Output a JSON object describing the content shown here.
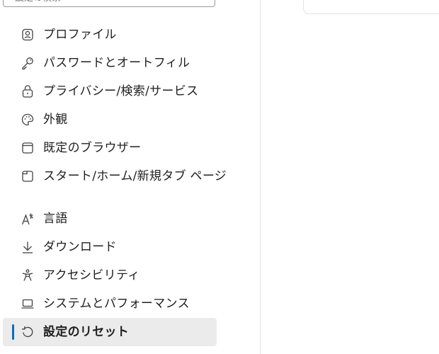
{
  "search": {
    "placeholder": "設定の検索"
  },
  "sidebar": {
    "items": [
      {
        "label": "プロファイル",
        "icon": "profile-icon",
        "selected": false
      },
      {
        "label": "パスワードとオートフィル",
        "icon": "key-icon",
        "selected": false
      },
      {
        "label": "プライバシー/検索/サービス",
        "icon": "lock-icon",
        "selected": false
      },
      {
        "label": "外観",
        "icon": "palette-icon",
        "selected": false
      },
      {
        "label": "既定のブラウザー",
        "icon": "browser-window-icon",
        "selected": false
      },
      {
        "label": "スタート/ホーム/新規タブ ページ",
        "icon": "home-page-icon",
        "selected": false
      },
      {
        "label": "言語",
        "icon": "language-icon",
        "selected": false
      },
      {
        "label": "ダウンロード",
        "icon": "download-icon",
        "selected": false
      },
      {
        "label": "アクセシビリティ",
        "icon": "accessibility-icon",
        "selected": false
      },
      {
        "label": "システムとパフォーマンス",
        "icon": "laptop-icon",
        "selected": false
      },
      {
        "label": "設定のリセット",
        "icon": "reset-icon",
        "selected": true
      }
    ]
  },
  "colors": {
    "accent": "#0f6cbd",
    "selected_bg": "#ebebeb",
    "text": "#1f1f1f",
    "icon": "#424242"
  }
}
